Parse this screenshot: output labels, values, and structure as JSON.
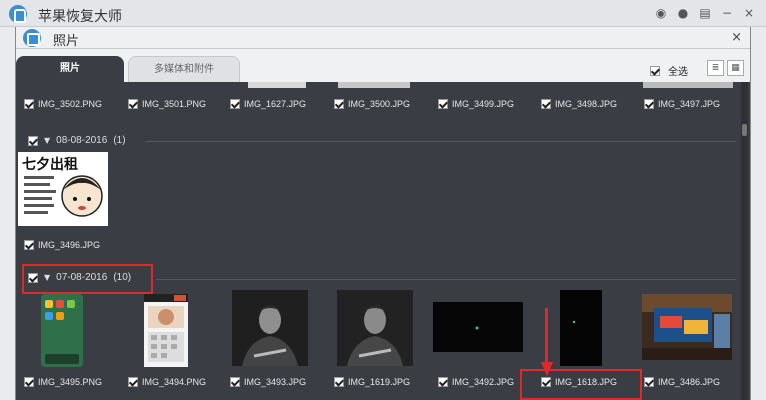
{
  "app": {
    "title": "苹果恢复大师"
  },
  "window": {
    "title": "照片",
    "close": "×"
  },
  "outer_icons": [
    "weibo-icon",
    "chat-icon",
    "feedback-icon",
    "minimize-icon",
    "close-icon"
  ],
  "outer_icon_glyphs": [
    "◉",
    "●",
    "▤",
    "−",
    "×"
  ],
  "tabs": {
    "photos": "照片",
    "media": "多媒体和附件"
  },
  "select_all": {
    "label": "全选",
    "checked": true
  },
  "view_buttons": {
    "list": "≣",
    "grid": "▦"
  },
  "top_row": [
    "IMG_3502.PNG",
    "IMG_3501.PNG",
    "IMG_1627.JPG",
    "IMG_3500.JPG",
    "IMG_3499.JPG",
    "IMG_3498.JPG",
    "IMG_3497.JPG"
  ],
  "groups": [
    {
      "date": "08-08-2016",
      "count": "(1)",
      "files": [
        "IMG_3496.JPG"
      ]
    },
    {
      "date": "07-08-2016",
      "count": "(10)",
      "files": [
        "IMG_3495.PNG",
        "IMG_3494.PNG",
        "IMG_3493.JPG",
        "IMG_1619.JPG",
        "IMG_3492.JPG",
        "IMG_1618.JPG",
        "IMG_3486.JPG"
      ]
    }
  ],
  "poster": {
    "heading": "七夕出租"
  },
  "colors": {
    "accent": "#3b8fd1",
    "highlight": "#e02a2a",
    "panel": "#3a3d43"
  }
}
